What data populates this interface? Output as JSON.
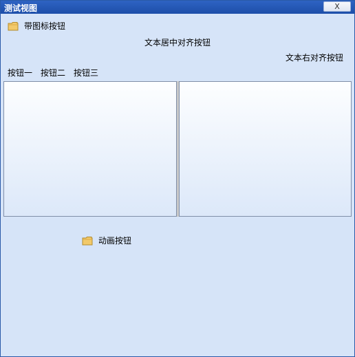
{
  "window": {
    "title": "测试视图",
    "close_label": "X"
  },
  "buttons": {
    "icon_button_label": "带图标按钮",
    "center_button_label": "文本居中对齐按钮",
    "right_button_label": "文本右对齐按钮",
    "button_one": "按钮一",
    "button_two": "按钮二",
    "button_three": "按钮三",
    "animate_button_label": "动画按钮"
  },
  "icons": {
    "icon_button": "folder-icon",
    "animate_button": "folder-icon"
  },
  "colors": {
    "title_bar": "#2459b8",
    "client_bg": "#d6e4f8",
    "folder": "#f2c96a"
  }
}
